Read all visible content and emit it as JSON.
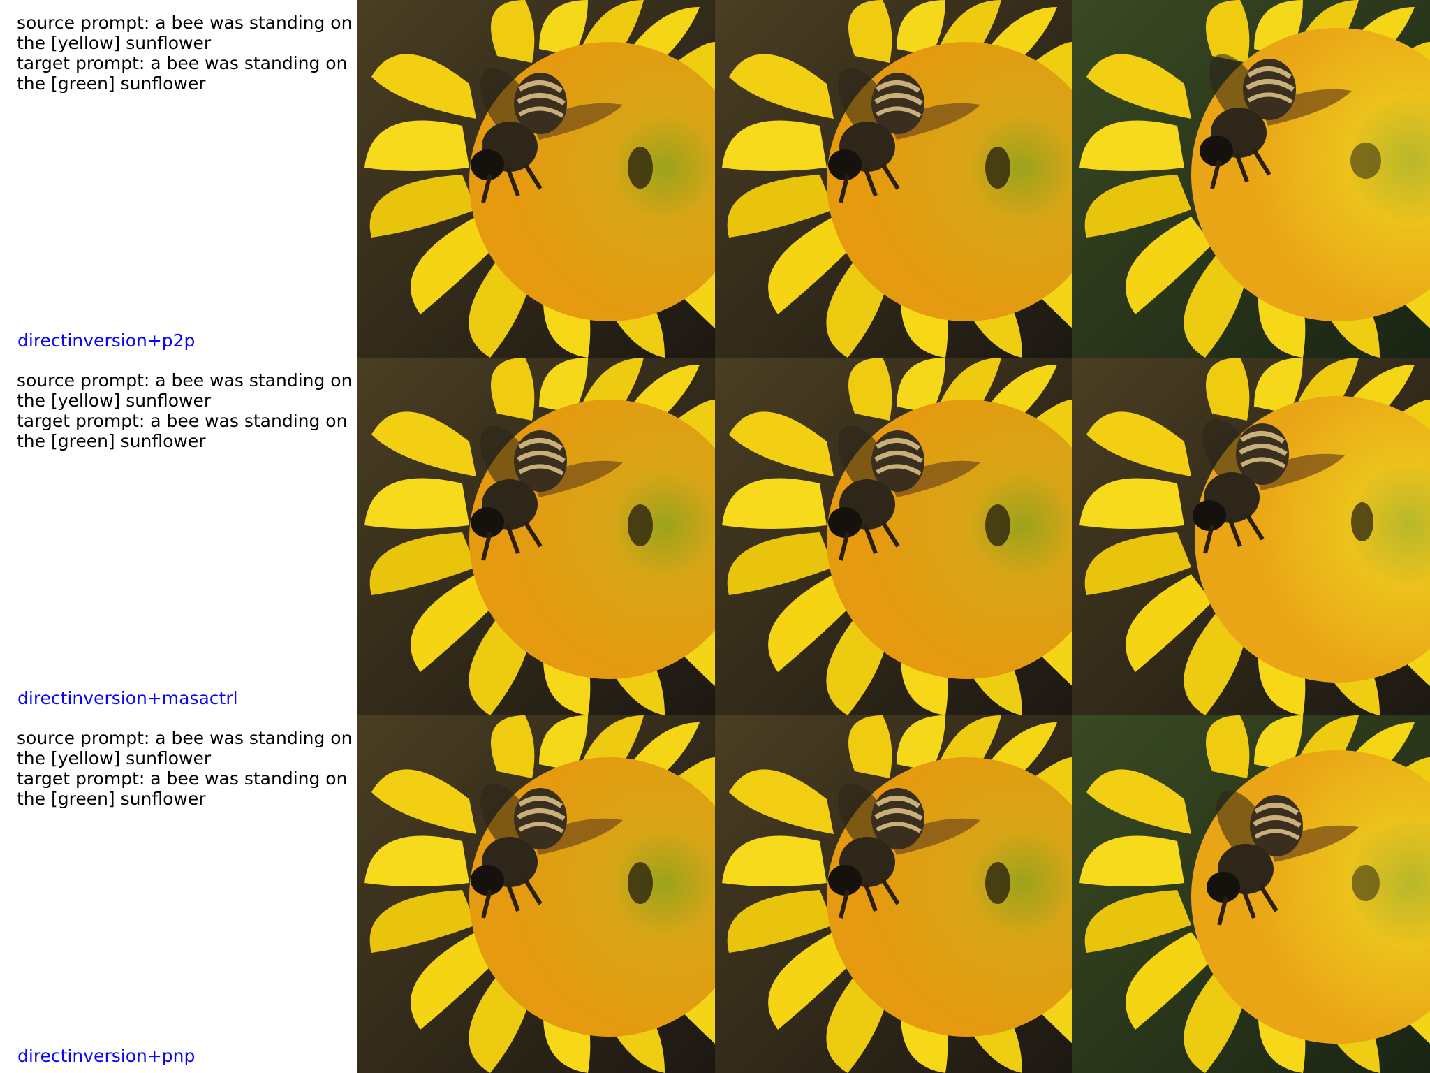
{
  "rows": [
    {
      "source_prompt": "source prompt: a bee was standing on the [yellow] sunflower",
      "target_prompt": "target prompt: a bee was standing on the [green] sunflower",
      "method": "directinversion+p2p",
      "images": [
        {
          "description": "bee on yellow sunflower (source)"
        },
        {
          "description": "bee on yellow sunflower (reconstruction)"
        },
        {
          "description": "bee on sunflower (edited, brighter petals)"
        }
      ]
    },
    {
      "source_prompt": "source prompt: a bee was standing on the [yellow] sunflower",
      "target_prompt": "target prompt: a bee was standing on the [green] sunflower",
      "method": "directinversion+masactrl",
      "images": [
        {
          "description": "bee on yellow sunflower (source)"
        },
        {
          "description": "bee on yellow sunflower (reconstruction)"
        },
        {
          "description": "bee on sunflower (edited)"
        }
      ]
    },
    {
      "source_prompt": "source prompt: a bee was standing on the [yellow] sunflower",
      "target_prompt": "target prompt: a bee was standing on the [green] sunflower",
      "method": "directinversion+pnp",
      "images": [
        {
          "description": "bee on yellow sunflower (source)"
        },
        {
          "description": "bee on yellow sunflower (reconstruction)"
        },
        {
          "description": "bee on sunflower (edited, fuzzier bee)"
        }
      ]
    }
  ],
  "colors": {
    "method_label": "#0a07f2",
    "prompt_text": "#000000",
    "petal": "#f5d20a",
    "disc": "#e0a012",
    "background": "#2a241a"
  }
}
